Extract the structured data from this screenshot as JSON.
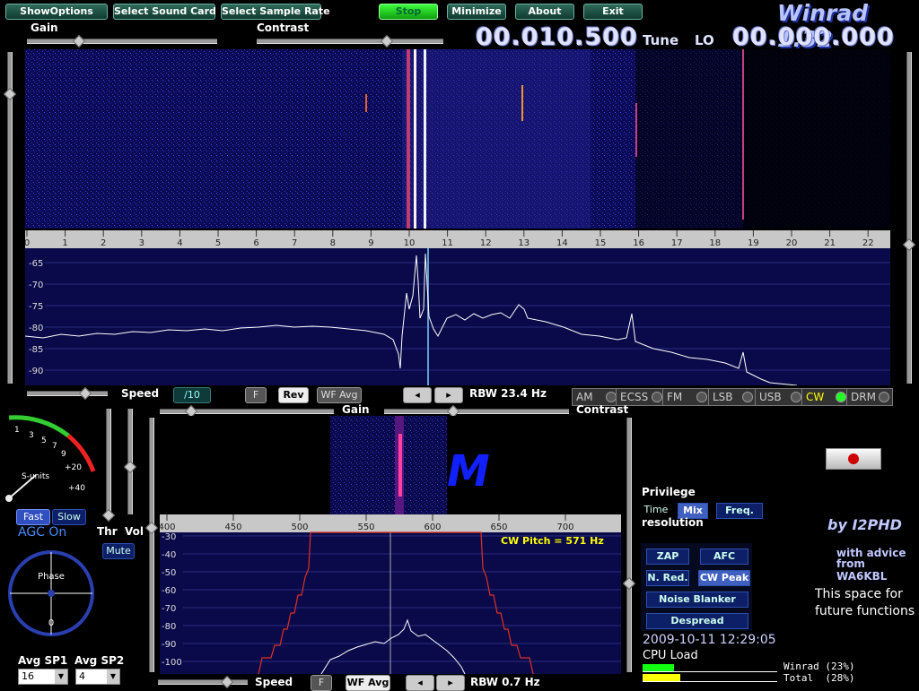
{
  "app": {
    "title": "Winrad 1.32"
  },
  "toolbar": {
    "show_options": "ShowOptions",
    "select_sound_card": "Select Sound Card",
    "select_sample_rate": "Select Sample Rate",
    "stop": "Stop",
    "minimize": "Minimize",
    "about": "About",
    "exit": "Exit"
  },
  "top_sliders": {
    "gain": "Gain",
    "contrast": "Contrast"
  },
  "tuning": {
    "tune_value": "00.010.500",
    "tune_label": "Tune",
    "lo_label": "LO",
    "lo_value": "00.000.000"
  },
  "main_spectrum": {
    "freq_ticks": [
      "0",
      "1",
      "2",
      "3",
      "4",
      "5",
      "6",
      "7",
      "8",
      "9",
      "10",
      "11",
      "12",
      "13",
      "14",
      "15",
      "16",
      "17",
      "18",
      "19",
      "20",
      "21",
      "22"
    ],
    "db_ticks": [
      "-65",
      "-70",
      "-75",
      "-80",
      "-85",
      "-90"
    ]
  },
  "main_controls": {
    "speed": "Speed",
    "div": "/10",
    "f": "F",
    "rev": "Rev",
    "wf_avg": "WF Avg",
    "rbw": "RBW 23.4 Hz"
  },
  "modes": [
    {
      "label": "AM",
      "active": false
    },
    {
      "label": "ECSS",
      "active": false
    },
    {
      "label": "FM",
      "active": false
    },
    {
      "label": "LSB",
      "active": false
    },
    {
      "label": "USB",
      "active": false
    },
    {
      "label": "CW",
      "active": true
    },
    {
      "label": "DRM",
      "active": false
    }
  ],
  "smeter": {
    "label": "S-units",
    "ticks": [
      "1",
      "3",
      "5",
      "7",
      "9",
      "+20",
      "+40"
    ]
  },
  "agc": {
    "fast": "Fast",
    "slow": "Slow",
    "status": "AGC On"
  },
  "audio": {
    "thr": "Thr",
    "vol": "Vol",
    "mute": "Mute"
  },
  "phase": {
    "label": "Phase",
    "value": "0"
  },
  "avg": {
    "sp1_label": "Avg SP1",
    "sp1_value": "16",
    "sp2_label": "Avg SP2",
    "sp2_value": "4"
  },
  "sec_sliders": {
    "gain": "Gain",
    "contrast": "Contrast"
  },
  "sec_spectrum": {
    "freq_ticks": [
      "400",
      "450",
      "500",
      "550",
      "600",
      "650",
      "700"
    ],
    "db_ticks": [
      "-30",
      "-40",
      "-50",
      "-60",
      "-70",
      "-80",
      "-90",
      "-100"
    ],
    "cw_pitch": "CW Pitch = 571 Hz"
  },
  "sec_controls": {
    "speed": "Speed",
    "f": "F",
    "wf_avg": "WF Avg",
    "rbw": "RBW  0.7 Hz"
  },
  "privilege": {
    "title": "Privilege",
    "time": "Time",
    "mix": "Mix",
    "freq": "Freq.",
    "resolution": "resolution"
  },
  "dsp": {
    "zap": "ZAP",
    "afc": "AFC",
    "nred": "N. Red.",
    "cwpeak": "CW Peak",
    "nb": "Noise Blanker",
    "despread": "Despread"
  },
  "status": {
    "datetime": "2009-10-11 12:29:05",
    "cpu_load": "CPU Load",
    "winrad": "Winrad (23%)",
    "total": "Total  (28%)",
    "winrad_pct": 23,
    "total_pct": 28
  },
  "credits": {
    "by": "by I2PHD",
    "advice1": "with advice",
    "advice2": "from WA6KBL",
    "future1": "This space for",
    "future2": "future functions"
  }
}
